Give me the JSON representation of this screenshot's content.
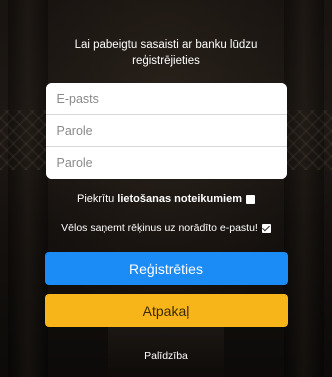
{
  "intro": {
    "line1": "Lai pabeigtu sasaisti ar banku lūdzu",
    "line2": "reģistrējieties"
  },
  "form": {
    "email_placeholder": "E-pasts",
    "password_placeholder": "Parole",
    "password_repeat_placeholder": "Parole"
  },
  "terms": {
    "prefix": "Piekrītu",
    "link": "lietošanas noteikumiem",
    "checked": false
  },
  "invoice": {
    "label": "Vēlos saņemt rēķinus uz norādīto e-pastu!",
    "checked": true
  },
  "buttons": {
    "register": "Reģistrēties",
    "back": "Atpakaļ"
  },
  "footer": {
    "help": "Palīdzība"
  },
  "colors": {
    "register_button": "#1b8bf5",
    "back_button": "#f8b51a"
  },
  "icons": {
    "terms_checkbox": "checkbox-unchecked-icon",
    "invoice_checkbox": "checkbox-checked-icon"
  }
}
